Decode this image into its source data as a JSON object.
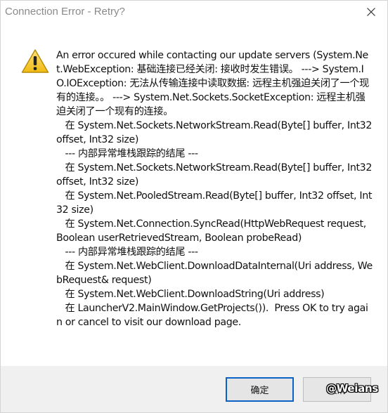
{
  "window": {
    "title": "Connection Error - Retry?"
  },
  "icons": {
    "close": "close-icon",
    "warning": "warning-icon"
  },
  "message": "An error occured while contacting our update servers (System.Net.WebException: 基础连接已经关闭: 接收时发生错误。 ---> System.IO.IOException: 无法从传输连接中读取数据: 远程主机强迫关闭了一个现有的连接。。 ---> System.Net.Sockets.SocketException: 远程主机强迫关闭了一个现有的连接。\n   在 System.Net.Sockets.NetworkStream.Read(Byte[] buffer, Int32 offset, Int32 size)\n   --- 内部异常堆栈跟踪的结尾 ---\n   在 System.Net.Sockets.NetworkStream.Read(Byte[] buffer, Int32 offset, Int32 size)\n   在 System.Net.PooledStream.Read(Byte[] buffer, Int32 offset, Int32 size)\n   在 System.Net.Connection.SyncRead(HttpWebRequest request, Boolean userRetrievedStream, Boolean probeRead)\n   --- 内部异常堆栈跟踪的结尾 ---\n   在 System.Net.WebClient.DownloadDataInternal(Uri address, WebRequest& request)\n   在 System.Net.WebClient.DownloadString(Uri address)\n   在 LauncherV2.MainWindow.GetProjects()).  Press OK to try again or cancel to visit our download page.",
  "buttons": {
    "ok": "确定",
    "cancel": "取消"
  },
  "watermark": "@Weians",
  "colors": {
    "title_text": "#8a8a8a",
    "footer_bg": "#f0f0f0",
    "default_button_border": "#0a62c7",
    "warning_fill": "#f4c51f"
  }
}
